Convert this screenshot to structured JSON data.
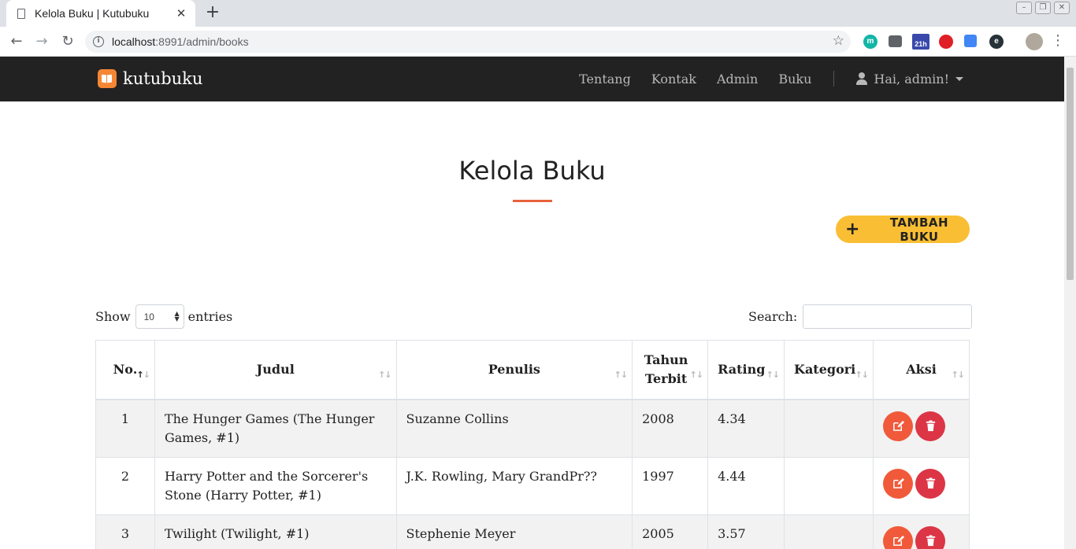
{
  "browser": {
    "tab_title": "Kelola Buku | Kutubuku",
    "url_host": "localhost",
    "url_rest": ":8991/admin/books",
    "extensions": [
      {
        "icon": "m-extension-icon",
        "label": "m",
        "color": "#12b5a6"
      },
      {
        "icon": "chat-extension-icon",
        "label": "",
        "color": "#5f6368"
      },
      {
        "icon": "calendar-extension-icon",
        "label": "21h",
        "color": "#3949ab"
      },
      {
        "icon": "opera-extension-icon",
        "label": "",
        "color": "#e01e26"
      },
      {
        "icon": "translate-extension-icon",
        "label": "",
        "color": "#4285f4"
      },
      {
        "icon": "e-extension-icon",
        "label": "e",
        "color": "#263238"
      }
    ]
  },
  "site": {
    "brand": "kutubuku",
    "nav": [
      "Tentang",
      "Kontak",
      "Admin",
      "Buku"
    ],
    "user_greeting": "Hai, admin!"
  },
  "page": {
    "title": "Kelola Buku",
    "add_button": "TAMBAH BUKU",
    "show_label": "Show",
    "entries_label": "entries",
    "page_length": "10",
    "search_label": "Search:",
    "search_value": ""
  },
  "table": {
    "columns": [
      "No.",
      "Judul",
      "Penulis",
      "Tahun Terbit",
      "Rating",
      "Kategori",
      "Aksi"
    ],
    "rows": [
      {
        "no": "1",
        "judul": "The Hunger Games (The Hunger Games, #1)",
        "penulis": "Suzanne Collins",
        "tahun": "2008",
        "rating": "4.34",
        "kategori": ""
      },
      {
        "no": "2",
        "judul": "Harry Potter and the Sorcerer's Stone (Harry Potter, #1)",
        "penulis": "J.K. Rowling, Mary GrandPr??",
        "tahun": "1997",
        "rating": "4.44",
        "kategori": ""
      },
      {
        "no": "3",
        "judul": "Twilight (Twilight, #1)",
        "penulis": "Stephenie Meyer",
        "tahun": "2005",
        "rating": "3.57",
        "kategori": ""
      }
    ]
  },
  "colors": {
    "navbar": "#222222",
    "accent": "#e8623d",
    "add_button": "#f9be33",
    "edit_button": "#f05a3a",
    "delete_button": "#dc3545"
  }
}
